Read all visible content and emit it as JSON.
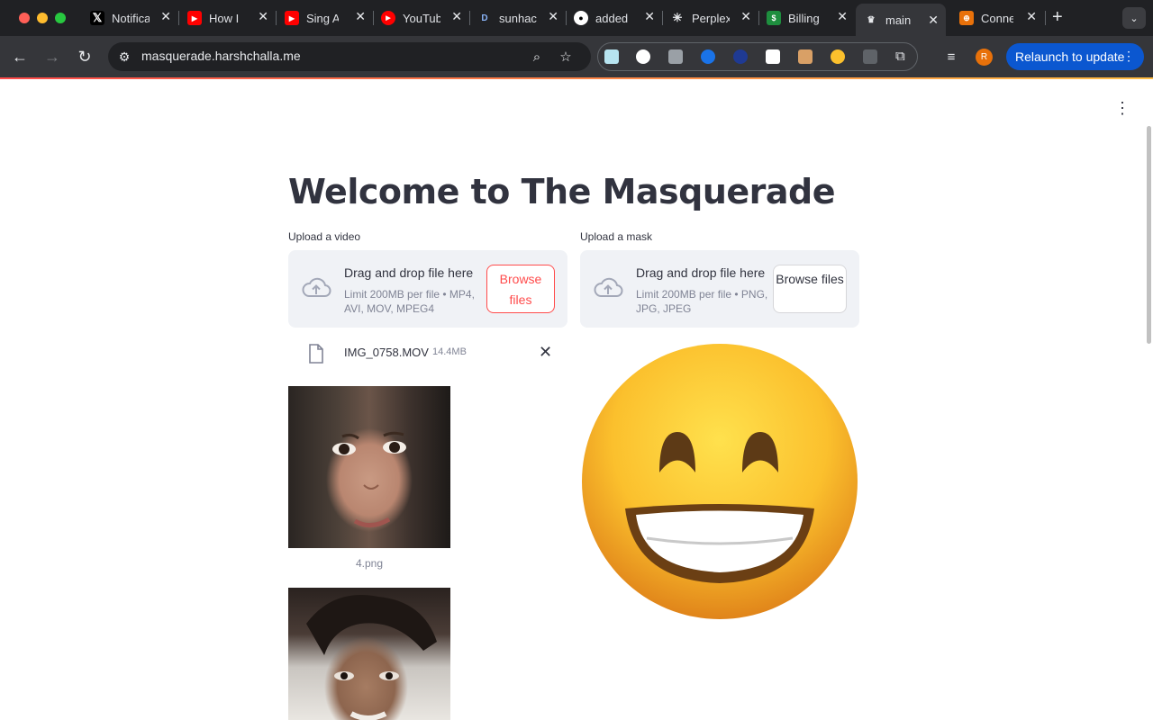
{
  "browser": {
    "tabs": [
      {
        "title": "Notifications / X",
        "favicon": "x-logo",
        "color": "#000000"
      },
      {
        "title": "How I",
        "favicon": "youtube-logo",
        "color": "#ff0000"
      },
      {
        "title": "Sing A",
        "favicon": "youtube-logo",
        "color": "#ff0000"
      },
      {
        "title": "YouTube",
        "favicon": "youtube-music-logo",
        "color": "#ff0000"
      },
      {
        "title": "sunhacks",
        "favicon": "devpost-logo",
        "color": "#003e54"
      },
      {
        "title": "added",
        "favicon": "github-logo",
        "color": "#ffffff"
      },
      {
        "title": "Perplexity",
        "favicon": "perplexity-logo",
        "color": "#20808d"
      },
      {
        "title": "Billing",
        "favicon": "billing-logo",
        "color": "#1e8e3e"
      },
      {
        "title": "main",
        "favicon": "streamlit-logo",
        "color": "#ff4b4b",
        "active": true
      },
      {
        "title": "Connect",
        "favicon": "connect-logo",
        "color": "#e8710a"
      }
    ],
    "url": "masquerade.harshchalla.me",
    "profile_initial": "R",
    "relaunch_label": "Relaunch to update"
  },
  "page": {
    "title": "Welcome to The Masquerade",
    "video_uploader": {
      "label": "Upload a video",
      "drop_text": "Drag and drop file here",
      "limit_text": "Limit 200MB per file • MP4, AVI, MOV, MPEG4",
      "browse_label": "Browse files"
    },
    "mask_uploader": {
      "label": "Upload a mask",
      "drop_text": "Drag and drop file here",
      "limit_text": "Limit 200MB per file • PNG, JPG, JPEG",
      "browse_label": "Browse files"
    },
    "uploaded_file": {
      "name": "IMG_0758.MOV",
      "size": "14.4MB"
    },
    "images": [
      {
        "caption": "4.png"
      },
      {
        "caption": ""
      }
    ],
    "mask_preview": "grinning-face-emoji"
  }
}
